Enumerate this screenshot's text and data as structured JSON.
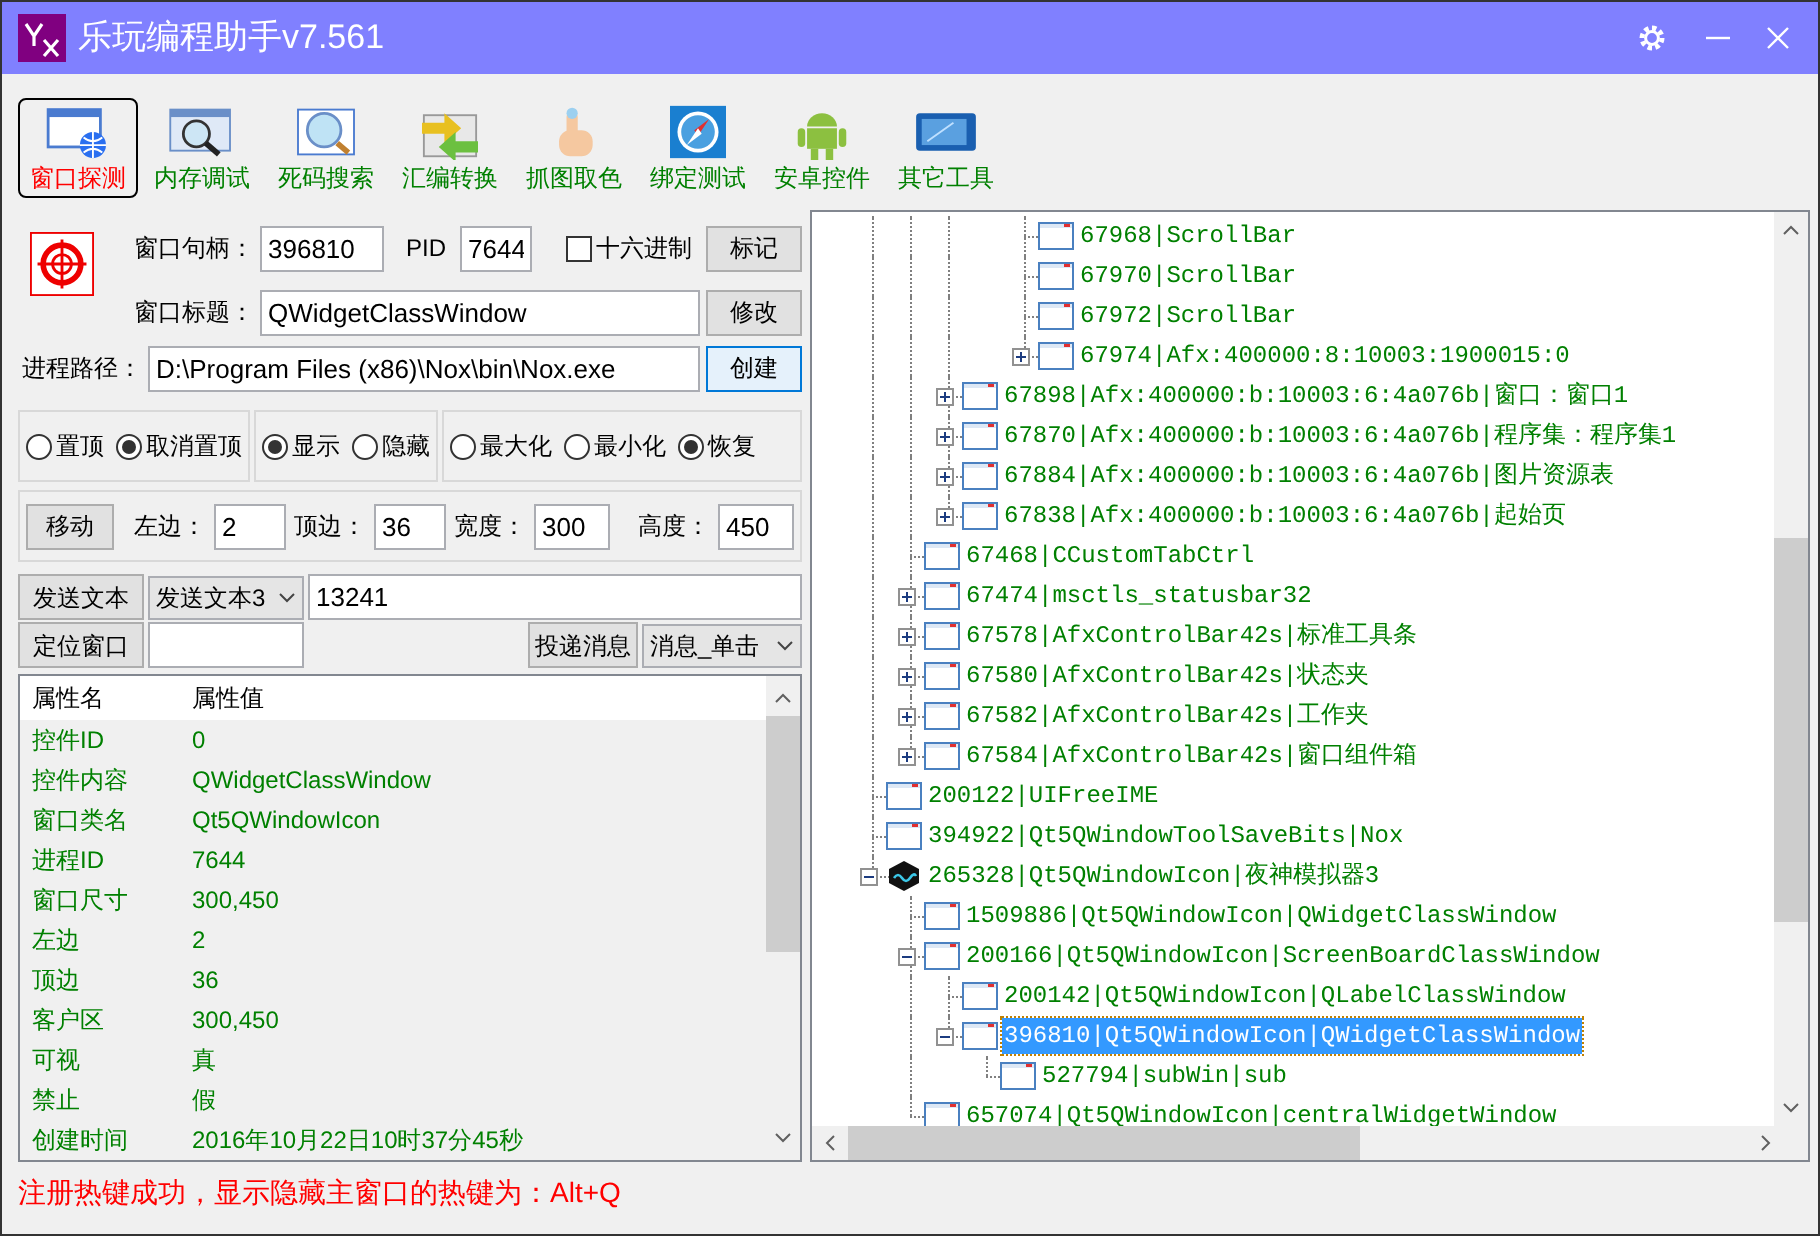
{
  "window": {
    "title": "乐玩编程助手v7.561"
  },
  "toolbar": [
    {
      "label": "窗口探测",
      "kind": "probe",
      "selected": true
    },
    {
      "label": "内存调试",
      "kind": "memory",
      "selected": false
    },
    {
      "label": "死码搜索",
      "kind": "search",
      "selected": false
    },
    {
      "label": "汇编转换",
      "kind": "convert",
      "selected": false
    },
    {
      "label": "抓图取色",
      "kind": "picker",
      "selected": false
    },
    {
      "label": "绑定测试",
      "kind": "compass",
      "selected": false
    },
    {
      "label": "安卓控件",
      "kind": "android",
      "selected": false
    },
    {
      "label": "其它工具",
      "kind": "tools",
      "selected": false
    }
  ],
  "window_info": {
    "handle_label": "窗口句柄：",
    "handle": "396810",
    "pid_label": "PID",
    "pid": "7644",
    "hex": {
      "label": "十六进制",
      "checked": false
    },
    "mark_button": "标记",
    "title_label": "窗口标题：",
    "title": "QWidgetClassWindow",
    "modify_button": "修改",
    "path_label": "进程路径：",
    "path": "D:\\Program Files (x86)\\Nox\\bin\\Nox.exe",
    "create_button": "创建"
  },
  "radio_groups": [
    [
      {
        "label": "置顶",
        "selected": false
      },
      {
        "label": "取消置顶",
        "selected": true
      }
    ],
    [
      {
        "label": "显示",
        "selected": true
      },
      {
        "label": "隐藏",
        "selected": false
      }
    ],
    [
      {
        "label": "最大化",
        "selected": false
      },
      {
        "label": "最小化",
        "selected": false
      },
      {
        "label": "恢复",
        "selected": true
      }
    ]
  ],
  "move": {
    "button": "移动",
    "fields": [
      {
        "label": "左边：",
        "value": "2"
      },
      {
        "label": "顶边：",
        "value": "36"
      },
      {
        "label": "宽度：",
        "value": "300"
      },
      {
        "label": "高度：",
        "value": "450"
      }
    ]
  },
  "send": {
    "button": "发送文本",
    "select": "发送文本3",
    "value": "13241"
  },
  "locate": {
    "button": "定位窗口",
    "post_button": "投递消息",
    "message_select": "消息_单击"
  },
  "properties": {
    "columns": [
      "属性名",
      "属性值"
    ],
    "rows": [
      [
        "控件ID",
        "0"
      ],
      [
        "控件内容",
        "QWidgetClassWindow"
      ],
      [
        "窗口类名",
        "Qt5QWindowIcon"
      ],
      [
        "进程ID",
        "7644"
      ],
      [
        "窗口尺寸",
        "300,450"
      ],
      [
        "左边",
        "2"
      ],
      [
        "顶边",
        "36"
      ],
      [
        "客户区",
        "300,450"
      ],
      [
        "可视",
        "真"
      ],
      [
        "禁止",
        "假"
      ],
      [
        "创建时间",
        "2016年10月22日10时37分45秒"
      ]
    ]
  },
  "tree": {
    "nodes": [
      {
        "children": [
          {
            "children": [
              {
                "children": [
                  {
                    "children": [
                      {
                        "label": "67968|ScrollBar",
                        "kind": "window",
                        "selected": false
                      },
                      {
                        "label": "67970|ScrollBar",
                        "kind": "window",
                        "selected": false
                      },
                      {
                        "label": "67972|ScrollBar",
                        "kind": "window",
                        "selected": false
                      },
                      {
                        "label": "67974|Afx:400000:8:10003:1900015:0",
                        "kind": "window",
                        "selected": false,
                        "expanded": false
                      }
                    ]
                  }
                ]
              },
              {
                "label": "67898|Afx:400000:b:10003:6:4a076b|窗口：窗口1",
                "kind": "window",
                "selected": false,
                "expanded": false
              },
              {
                "label": "67870|Afx:400000:b:10003:6:4a076b|程序集：程序集1",
                "kind": "window",
                "selected": false,
                "expanded": false
              },
              {
                "label": "67884|Afx:400000:b:10003:6:4a076b|图片资源表",
                "kind": "window",
                "selected": false,
                "expanded": false
              },
              {
                "label": "67838|Afx:400000:b:10003:6:4a076b|起始页",
                "kind": "window",
                "selected": false,
                "expanded": false
              }
            ]
          },
          {
            "label": "67468|CCustomTabCtrl",
            "kind": "window",
            "selected": false
          },
          {
            "label": "67474|msctls_statusbar32",
            "kind": "window",
            "selected": false,
            "expanded": false
          },
          {
            "label": "67578|AfxControlBar42s|标准工具条",
            "kind": "window",
            "selected": false,
            "expanded": false
          },
          {
            "label": "67580|AfxControlBar42s|状态夹",
            "kind": "window",
            "selected": false,
            "expanded": false
          },
          {
            "label": "67582|AfxControlBar42s|工作夹",
            "kind": "window",
            "selected": false,
            "expanded": false
          },
          {
            "label": "67584|AfxControlBar42s|窗口组件箱",
            "kind": "window",
            "selected": false,
            "expanded": false
          }
        ]
      },
      {
        "label": "200122|UIFreeIME",
        "kind": "window",
        "selected": false
      },
      {
        "label": "394922|Qt5QWindowToolSaveBits|Nox",
        "kind": "window",
        "selected": false
      },
      {
        "label": "265328|Qt5QWindowIcon|夜神模拟器3",
        "kind": "app",
        "selected": false,
        "expanded": true,
        "children": [
          {
            "label": "1509886|Qt5QWindowIcon|QWidgetClassWindow",
            "kind": "window",
            "selected": false
          },
          {
            "label": "200166|Qt5QWindowIcon|ScreenBoardClassWindow",
            "kind": "window",
            "selected": false,
            "expanded": true,
            "children": [
              {
                "label": "200142|Qt5QWindowIcon|QLabelClassWindow",
                "kind": "window",
                "selected": false
              },
              {
                "label": "396810|Qt5QWindowIcon|QWidgetClassWindow",
                "kind": "window",
                "selected": true,
                "expanded": true,
                "children": [
                  {
                    "label": "527794|subWin|sub",
                    "kind": "window",
                    "selected": false
                  }
                ]
              }
            ]
          },
          {
            "label": "657074|Qt5QWindowIcon|centralWidgetWindow",
            "kind": "window",
            "selected": false
          }
        ]
      }
    ]
  },
  "status_bar": "注册热键成功，显示隐藏主窗口的热键为：Alt+Q"
}
